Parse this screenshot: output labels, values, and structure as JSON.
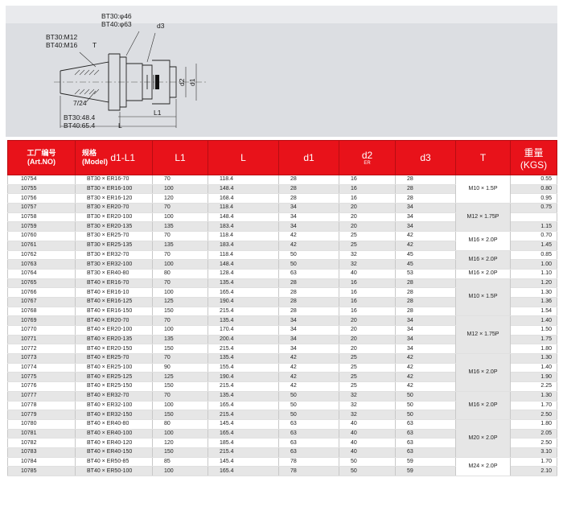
{
  "diagram": {
    "label_bt30_phi": "BT30:φ46",
    "label_bt40_phi": "BT40:φ63",
    "label_d3": "d3",
    "label_bt30_thread": "BT30:M12",
    "label_bt40_thread": "BT40:M16",
    "label_t": "T",
    "label_taper": "7/24",
    "label_d2": "d2",
    "label_d1": "d1",
    "label_l1": "L1",
    "label_bt30_len": "BT30:48.4",
    "label_bt40_len": "BT40:65.4",
    "label_l": "L"
  },
  "table": {
    "headers": {
      "art_cn": "工厂编号",
      "art_en": "(Art.NO)",
      "model_cn": "规格",
      "model_en": "(Model)",
      "model_dim": "d1-L1",
      "l1": "L1",
      "l": "L",
      "d1": "d1",
      "d2": "d2",
      "d2_sub": "ER",
      "d3": "d3",
      "t": "T",
      "weight_cn": "重量",
      "weight_en": "(KGS)"
    },
    "rows": [
      {
        "art": "10754",
        "model": "BT30 × ER16-70",
        "l1": "70",
        "l": "118.4",
        "d1": "28",
        "d2": "16",
        "d3": "28",
        "weight": "0.55"
      },
      {
        "art": "10755",
        "model": "BT30 × ER16-100",
        "l1": "100",
        "l": "148.4",
        "d1": "28",
        "d2": "16",
        "d3": "28",
        "weight": "0.80"
      },
      {
        "art": "10756",
        "model": "BT30 × ER16-120",
        "l1": "120",
        "l": "168.4",
        "d1": "28",
        "d2": "16",
        "d3": "28",
        "weight": "0.95"
      },
      {
        "art": "10757",
        "model": "BT30 × ER20-70",
        "l1": "70",
        "l": "118.4",
        "d1": "34",
        "d2": "20",
        "d3": "34",
        "weight": "0.75"
      },
      {
        "art": "10758",
        "model": "BT30 × ER20-100",
        "l1": "100",
        "l": "148.4",
        "d1": "34",
        "d2": "20",
        "d3": "34",
        "weight": ""
      },
      {
        "art": "10759",
        "model": "BT30 × ER20-135",
        "l1": "135",
        "l": "183.4",
        "d1": "34",
        "d2": "20",
        "d3": "34",
        "weight": "1.15"
      },
      {
        "art": "10760",
        "model": "BT30 × ER25-70",
        "l1": "70",
        "l": "118.4",
        "d1": "42",
        "d2": "25",
        "d3": "42",
        "weight": "0.70"
      },
      {
        "art": "10761",
        "model": "BT30 × ER25-135",
        "l1": "135",
        "l": "183.4",
        "d1": "42",
        "d2": "25",
        "d3": "42",
        "weight": "1.45"
      },
      {
        "art": "10762",
        "model": "BT30 × ER32-70",
        "l1": "70",
        "l": "118.4",
        "d1": "50",
        "d2": "32",
        "d3": "45",
        "weight": "0.85"
      },
      {
        "art": "10763",
        "model": "BT30 × ER32-100",
        "l1": "100",
        "l": "148.4",
        "d1": "50",
        "d2": "32",
        "d3": "45",
        "weight": "1.00"
      },
      {
        "art": "10764",
        "model": "BT30 × ER40-80",
        "l1": "80",
        "l": "128.4",
        "d1": "63",
        "d2": "40",
        "d3": "53",
        "weight": "1.10"
      },
      {
        "art": "10765",
        "model": "BT40 × ER16-70",
        "l1": "70",
        "l": "135.4",
        "d1": "28",
        "d2": "16",
        "d3": "28",
        "weight": "1.20"
      },
      {
        "art": "10766",
        "model": "BT40 × ER16-10",
        "l1": "100",
        "l": "165.4",
        "d1": "28",
        "d2": "16",
        "d3": "28",
        "weight": "1.30"
      },
      {
        "art": "10767",
        "model": "BT40 × ER16-125",
        "l1": "125",
        "l": "190.4",
        "d1": "28",
        "d2": "16",
        "d3": "28",
        "weight": "1.36"
      },
      {
        "art": "10768",
        "model": "BT40 × ER16-150",
        "l1": "150",
        "l": "215.4",
        "d1": "28",
        "d2": "16",
        "d3": "28",
        "weight": "1.54"
      },
      {
        "art": "10769",
        "model": "BT40 × ER20-70",
        "l1": "70",
        "l": "135.4",
        "d1": "34",
        "d2": "20",
        "d3": "34",
        "weight": "1.40"
      },
      {
        "art": "10770",
        "model": "BT40 × ER20-100",
        "l1": "100",
        "l": "170.4",
        "d1": "34",
        "d2": "20",
        "d3": "34",
        "weight": "1.50"
      },
      {
        "art": "10771",
        "model": "BT40 × ER20-135",
        "l1": "135",
        "l": "200.4",
        "d1": "34",
        "d2": "20",
        "d3": "34",
        "weight": "1.75"
      },
      {
        "art": "10772",
        "model": "BT40 × ER20-150",
        "l1": "150",
        "l": "215.4",
        "d1": "34",
        "d2": "20",
        "d3": "34",
        "weight": "1.80"
      },
      {
        "art": "10773",
        "model": "BT40 × ER25-70",
        "l1": "70",
        "l": "135.4",
        "d1": "42",
        "d2": "25",
        "d3": "42",
        "weight": "1.30"
      },
      {
        "art": "10774",
        "model": "BT40 × ER25-100",
        "l1": "90",
        "l": "155.4",
        "d1": "42",
        "d2": "25",
        "d3": "42",
        "weight": "1.40"
      },
      {
        "art": "10775",
        "model": "BT40 × ER25-125",
        "l1": "125",
        "l": "190.4",
        "d1": "42",
        "d2": "25",
        "d3": "42",
        "weight": "1.90"
      },
      {
        "art": "10776",
        "model": "BT40 × ER25-150",
        "l1": "150",
        "l": "215.4",
        "d1": "42",
        "d2": "25",
        "d3": "42",
        "weight": "2.25"
      },
      {
        "art": "10777",
        "model": "BT40 × ER32-70",
        "l1": "70",
        "l": "135.4",
        "d1": "50",
        "d2": "32",
        "d3": "50",
        "weight": "1.30"
      },
      {
        "art": "10778",
        "model": "BT40 × ER32-100",
        "l1": "100",
        "l": "165.4",
        "d1": "50",
        "d2": "32",
        "d3": "50",
        "weight": "1.70"
      },
      {
        "art": "10779",
        "model": "BT40 × ER32-150",
        "l1": "150",
        "l": "215.4",
        "d1": "50",
        "d2": "32",
        "d3": "50",
        "weight": "2.50"
      },
      {
        "art": "10780",
        "model": "BT40 × ER40-80",
        "l1": "80",
        "l": "145.4",
        "d1": "63",
        "d2": "40",
        "d3": "63",
        "weight": "1.80"
      },
      {
        "art": "10781",
        "model": "BT40 × ER40-100",
        "l1": "100",
        "l": "165.4",
        "d1": "63",
        "d2": "40",
        "d3": "63",
        "weight": "2.05"
      },
      {
        "art": "10782",
        "model": "BT40 × ER40-120",
        "l1": "120",
        "l": "185.4",
        "d1": "63",
        "d2": "40",
        "d3": "63",
        "weight": "2.50"
      },
      {
        "art": "10783",
        "model": "BT40 × ER40-150",
        "l1": "150",
        "l": "215.4",
        "d1": "63",
        "d2": "40",
        "d3": "63",
        "weight": "3.10"
      },
      {
        "art": "10784",
        "model": "BT40 × ER50-85",
        "l1": "85",
        "l": "145.4",
        "d1": "78",
        "d2": "50",
        "d3": "59",
        "weight": "1.70"
      },
      {
        "art": "10785",
        "model": "BT40 × ER50-100",
        "l1": "100",
        "l": "165.4",
        "d1": "78",
        "d2": "50",
        "d3": "59",
        "weight": "2.10"
      }
    ],
    "t_groups": [
      {
        "label": "M10 × 1.5P",
        "start": 0,
        "span": 3
      },
      {
        "label": "M12 × 1.75P",
        "start": 3,
        "span": 3
      },
      {
        "label": "M16 × 2.0P",
        "start": 6,
        "span": 2
      },
      {
        "label": "M16 × 2.0P",
        "start": 8,
        "span": 2
      },
      {
        "label": "M16 × 2.0P",
        "start": 10,
        "span": 1
      },
      {
        "label": "M10 × 1.5P",
        "start": 11,
        "span": 4
      },
      {
        "label": "M12 × 1.75P",
        "start": 15,
        "span": 4
      },
      {
        "label": "M16 × 2.0P",
        "start": 19,
        "span": 4
      },
      {
        "label": "M16 × 2.0P",
        "start": 23,
        "span": 3
      },
      {
        "label": "M20 × 2.0P",
        "start": 26,
        "span": 4
      },
      {
        "label": "M24 × 2.0P",
        "start": 30,
        "span": 2
      }
    ]
  }
}
